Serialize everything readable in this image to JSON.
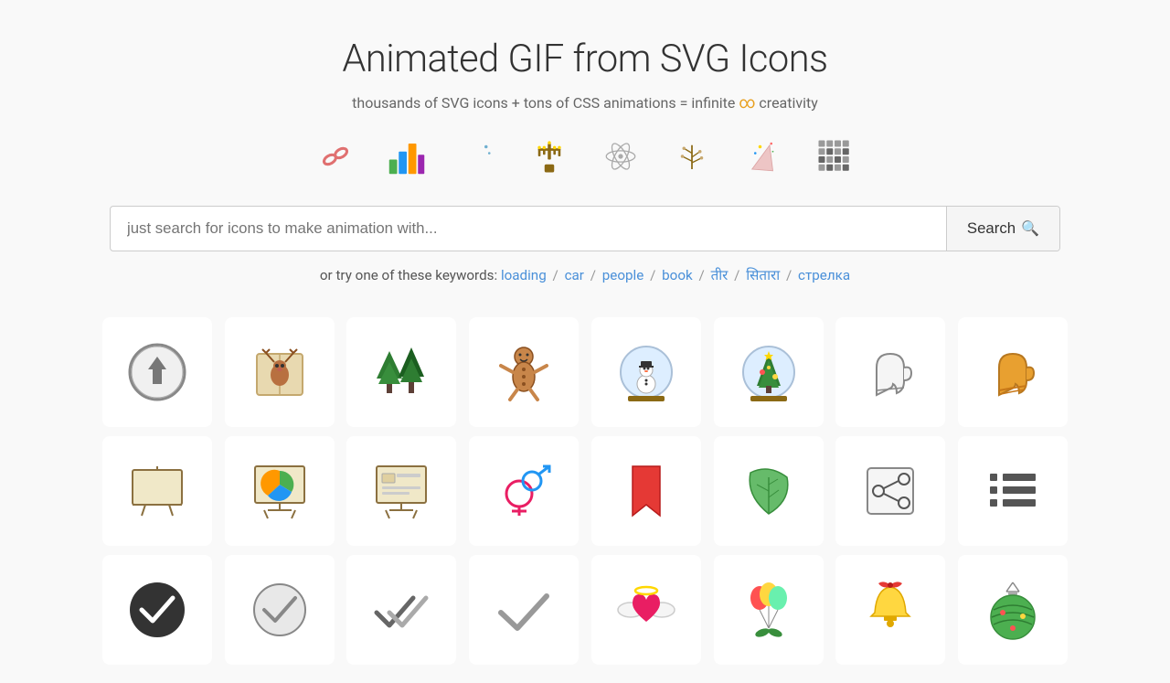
{
  "header": {
    "title": "Animated GIF from SVG Icons",
    "subtitle_pre": "thousands of SVG icons + tons of CSS animations = infinite",
    "subtitle_post": "creativity"
  },
  "search": {
    "placeholder": "just search for icons to make animation with...",
    "button_label": "Search"
  },
  "keywords": {
    "prefix": "or try one of these keywords:",
    "items": [
      "loading",
      "car",
      "people",
      "book",
      "तीर",
      "सितारा",
      "стрелка"
    ]
  },
  "icons": {
    "row1": [
      {
        "name": "upload-circle",
        "label": "Upload Circle"
      },
      {
        "name": "deer-card",
        "label": "Deer Card"
      },
      {
        "name": "trees",
        "label": "Trees"
      },
      {
        "name": "gingerbread",
        "label": "Gingerbread Man"
      },
      {
        "name": "snow-globe",
        "label": "Snow Globe"
      },
      {
        "name": "christmas-globe",
        "label": "Christmas Globe"
      },
      {
        "name": "mitten-outline",
        "label": "Mitten Outline"
      },
      {
        "name": "mitten-orange",
        "label": "Mitten Orange"
      }
    ],
    "row2": [
      {
        "name": "whiteboard",
        "label": "Whiteboard"
      },
      {
        "name": "pie-chart",
        "label": "Pie Chart"
      },
      {
        "name": "presentation",
        "label": "Presentation Board"
      },
      {
        "name": "gender",
        "label": "Gender"
      },
      {
        "name": "bookmark",
        "label": "Bookmark"
      },
      {
        "name": "leaf",
        "label": "Leaf"
      },
      {
        "name": "share",
        "label": "Share"
      },
      {
        "name": "list",
        "label": "List"
      }
    ],
    "row3": [
      {
        "name": "check-dark-circle",
        "label": "Check Dark Circle"
      },
      {
        "name": "check-circle-outline",
        "label": "Check Circle Outline"
      },
      {
        "name": "double-check",
        "label": "Double Check"
      },
      {
        "name": "check-gray",
        "label": "Check Gray"
      },
      {
        "name": "angel-heart",
        "label": "Angel Heart"
      },
      {
        "name": "balloon-bouquet",
        "label": "Balloon Bouquet"
      },
      {
        "name": "bell-gift",
        "label": "Bell Gift"
      },
      {
        "name": "ornament-ball",
        "label": "Ornament Ball"
      }
    ]
  }
}
